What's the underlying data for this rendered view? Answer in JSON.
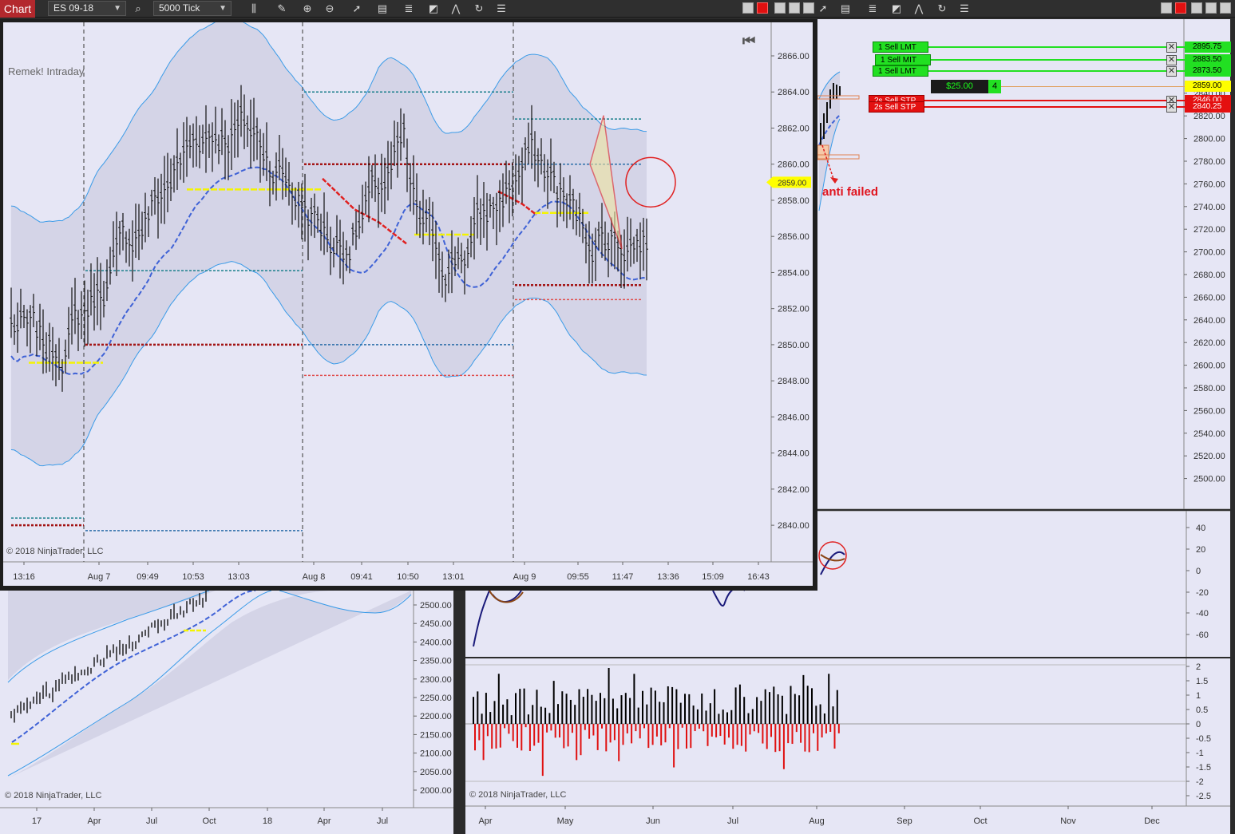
{
  "toolbar": {
    "chart_tab": "Chart",
    "instrument": "ES 09-18",
    "interval": "5000 Tick",
    "icons": [
      "search-icon",
      "bar-style-icon",
      "pencil-icon",
      "zoom-in-icon",
      "zoom-out-icon",
      "pointer-icon",
      "data-box-icon",
      "indicators-icon",
      "strategies-icon",
      "drawing-tools-icon",
      "reload-icon",
      "properties-icon"
    ]
  },
  "main_chart": {
    "indicator_label": "Remek! Intraday",
    "copyright": "© 2018 NinjaTrader, LLC",
    "current_price": "2859.00",
    "y_ticks": [
      "2866.00",
      "2864.00",
      "2862.00",
      "2860.00",
      "2858.00",
      "2856.00",
      "2854.00",
      "2852.00",
      "2850.00",
      "2848.00",
      "2846.00",
      "2844.00",
      "2842.00",
      "2840.00"
    ],
    "x_ticks": [
      "13:16",
      "Aug 7",
      "09:49",
      "10:53",
      "13:03",
      "Aug 8",
      "09:41",
      "10:50",
      "13:01",
      "Aug 9",
      "09:55",
      "11:47",
      "13:36",
      "15:09",
      "16:43"
    ]
  },
  "right_top_chart": {
    "annotation": "anti failed",
    "y_ticks": [
      "2880.00",
      "2860.00",
      "2840.00",
      "2820.00",
      "2800.00",
      "2780.00",
      "2760.00",
      "2740.00",
      "2720.00",
      "2700.00",
      "2680.00",
      "2660.00",
      "2640.00",
      "2620.00",
      "2600.00",
      "2580.00",
      "2560.00",
      "2540.00",
      "2520.00",
      "2500.00"
    ],
    "orders": [
      {
        "qty": "1",
        "label": "Sell LMT",
        "price": "2895.75",
        "color": "green"
      },
      {
        "qty": "1",
        "label": "Sell MIT",
        "price": "2883.50",
        "color": "green"
      },
      {
        "qty": "1",
        "label": "Sell LMT",
        "price": "2873.50",
        "color": "green"
      },
      {
        "qty": "2s",
        "label": "Sell STP",
        "price": "2846.00",
        "color": "red"
      },
      {
        "qty": "2s",
        "label": "Sell STP",
        "price": "2840.25",
        "color": "red"
      }
    ],
    "position": {
      "pnl": "$25.00",
      "qty": "4",
      "price": "2859.00"
    }
  },
  "oscillator_panel": {
    "y_ticks": [
      "40",
      "20",
      "0",
      "-20",
      "-40",
      "-60"
    ]
  },
  "histogram_panel": {
    "copyright": "© 2018 NinjaTrader, LLC",
    "y_ticks": [
      "2",
      "1.5",
      "1",
      "0.5",
      "0",
      "-0.5",
      "-1",
      "-1.5",
      "-2",
      "-2.5"
    ],
    "x_ticks": [
      "Apr",
      "May",
      "Jun",
      "Jul",
      "Aug",
      "Sep",
      "Oct",
      "Nov",
      "Dec"
    ]
  },
  "bottom_left_chart": {
    "copyright": "© 2018 NinjaTrader, LLC",
    "y_ticks": [
      "2500.00",
      "2450.00",
      "2400.00",
      "2350.00",
      "2300.00",
      "2250.00",
      "2200.00",
      "2150.00",
      "2100.00",
      "2050.00",
      "2000.00"
    ],
    "x_ticks": [
      "17",
      "Apr",
      "Jul",
      "Oct",
      "18",
      "Apr",
      "Jul"
    ]
  },
  "colors": {
    "panel_bg": "#e6e6f5",
    "band": "#cfd0e3",
    "envelope": "#3a9be8",
    "trail_blue": "#3f62d6",
    "trail_yellow": "#f4f400",
    "trail_red": "#e02020",
    "level_teal": "#1a7f8c",
    "level_darkred": "#a31515",
    "accent": "#b3282d"
  }
}
